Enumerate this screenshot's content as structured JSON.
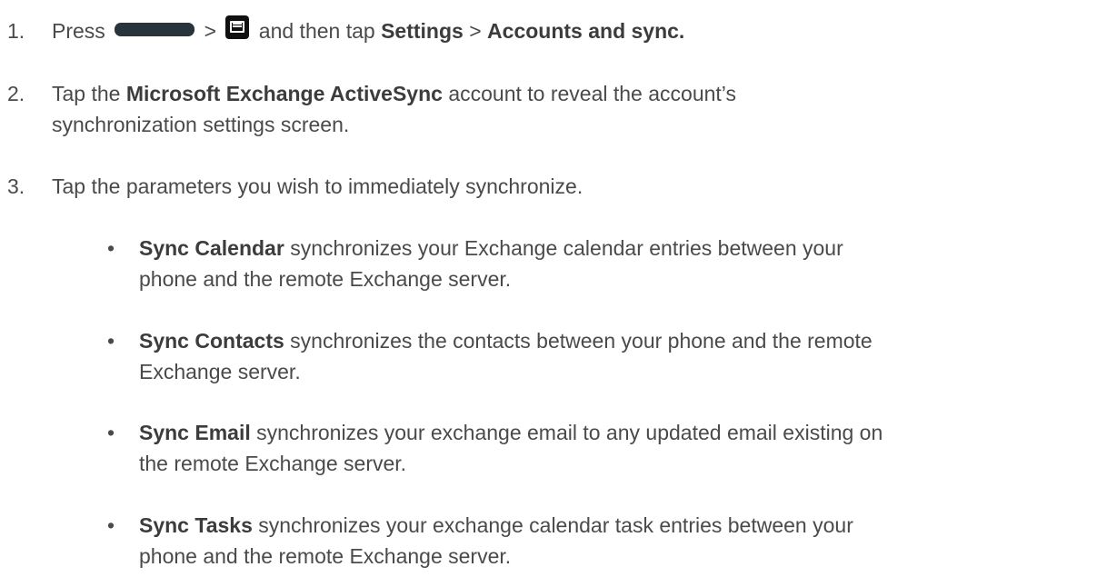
{
  "steps": [
    {
      "number": "1.",
      "press": "Press",
      "gt1": ">",
      "and_then_tap": "and then tap",
      "settings": "Settings",
      "gt2": ">",
      "accounts": "Accounts and sync."
    },
    {
      "number": "2.",
      "tap": "Tap the",
      "account_name": "Microsoft Exchange ActiveSync",
      "rest_line1": "account to reveal the account’s",
      "rest_line2": "synchronization settings screen."
    },
    {
      "number": "3.",
      "text": "Tap the parameters you wish to immediately synchronize."
    }
  ],
  "bullets": [
    {
      "marker": "•",
      "term": "Sync Calendar",
      "rest_line1": "synchronizes your Exchange calendar entries between your",
      "rest_line2": "phone and the remote Exchange server."
    },
    {
      "marker": "•",
      "term": "Sync Contacts",
      "rest_line1": "synchronizes the contacts between your phone and the remote",
      "rest_line2": "Exchange server."
    },
    {
      "marker": "•",
      "term": "Sync Email",
      "rest_line1": "synchronizes your exchange email to any updated email existing on",
      "rest_line2": "the remote Exchange server."
    },
    {
      "marker": "•",
      "term": "Sync Tasks",
      "rest_line1": "synchronizes your exchange calendar task entries between your",
      "rest_line2": "phone and the remote Exchange server."
    }
  ],
  "icons": {
    "home_key": "home-key-icon",
    "menu_key": "menu-key-icon"
  }
}
